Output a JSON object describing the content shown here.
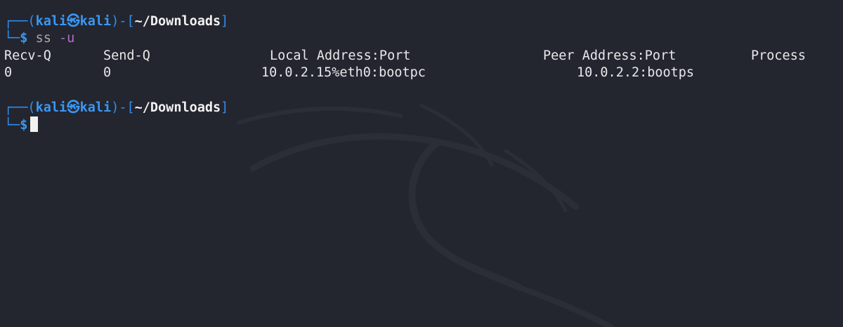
{
  "prompt1": {
    "tree_top": "┌──",
    "open_paren": "(",
    "user": "kali",
    "at": "㉿",
    "host": "kali",
    "close_paren": ")",
    "dash": "-",
    "open_bracket": "[",
    "dir": "~/Downloads",
    "close_bracket": "]",
    "tree_bottom": "└─",
    "dollar": "$",
    "command": "ss",
    "flag": "-u"
  },
  "table": {
    "headers": [
      "Recv-Q",
      "Send-Q",
      "Local Address:Port",
      "Peer Address:Port",
      "Process"
    ],
    "rows": [
      [
        "0",
        "0",
        "10.0.2.15%eth0:bootpc",
        "10.0.2.2:bootps",
        ""
      ]
    ]
  },
  "prompt2": {
    "tree_top": "┌──",
    "open_paren": "(",
    "user": "kali",
    "at": "㉿",
    "host": "kali",
    "close_paren": ")",
    "dash": "-",
    "open_bracket": "[",
    "dir": "~/Downloads",
    "close_bracket": "]",
    "tree_bottom": "└─",
    "dollar": "$"
  },
  "colors": {
    "background": "#23262f",
    "prompt_blue": "#2f8ff0",
    "flag_purple": "#b072c8"
  }
}
